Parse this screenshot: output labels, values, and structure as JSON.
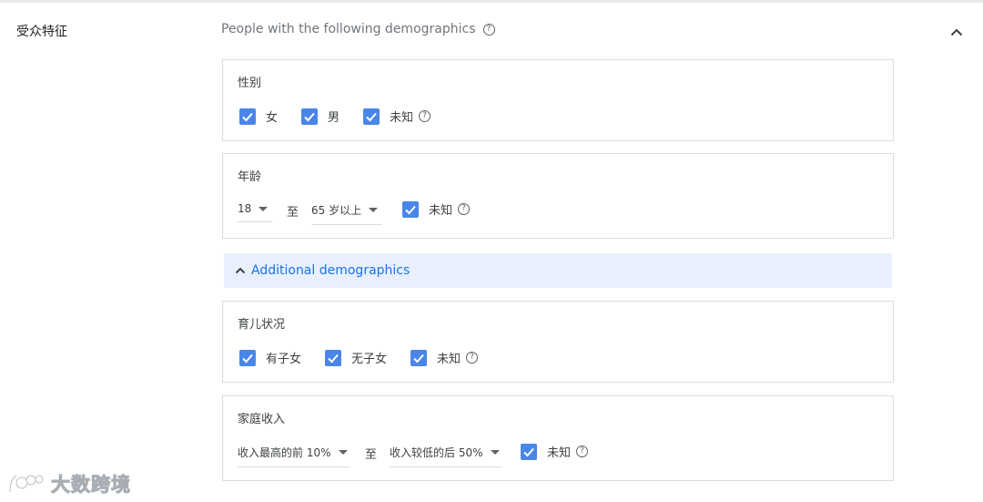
{
  "section": {
    "label": "受众特征",
    "subtitle": "People with the following demographics",
    "help_icon_glyph": "?",
    "collapse_icon": "chevron-up-icon"
  },
  "gender": {
    "title": "性别",
    "options": [
      {
        "label": "女",
        "checked": true
      },
      {
        "label": "男",
        "checked": true
      },
      {
        "label": "未知",
        "checked": true
      }
    ]
  },
  "age": {
    "title": "年龄",
    "from_value": "18",
    "separator": "至",
    "to_value": "65 岁以上",
    "unknown_label": "未知",
    "unknown_checked": true
  },
  "additional": {
    "label": "Additional demographics",
    "icon": "chevron-up-icon"
  },
  "parental": {
    "title": "育儿状况",
    "options": [
      {
        "label": "有子女",
        "checked": true
      },
      {
        "label": "无子女",
        "checked": true
      },
      {
        "label": "未知",
        "checked": true
      }
    ]
  },
  "income": {
    "title": "家庭收入",
    "from_value": "收入最高的前 10%",
    "separator": "至",
    "to_value": "收入较低的后 50%",
    "unknown_label": "未知",
    "unknown_checked": true
  },
  "watermark": {
    "text": "大数跨境"
  },
  "colors": {
    "checkbox": "#4a86e8",
    "link": "#1a73e8",
    "bar_bg": "#e8f0fe",
    "border": "#dadce0"
  }
}
